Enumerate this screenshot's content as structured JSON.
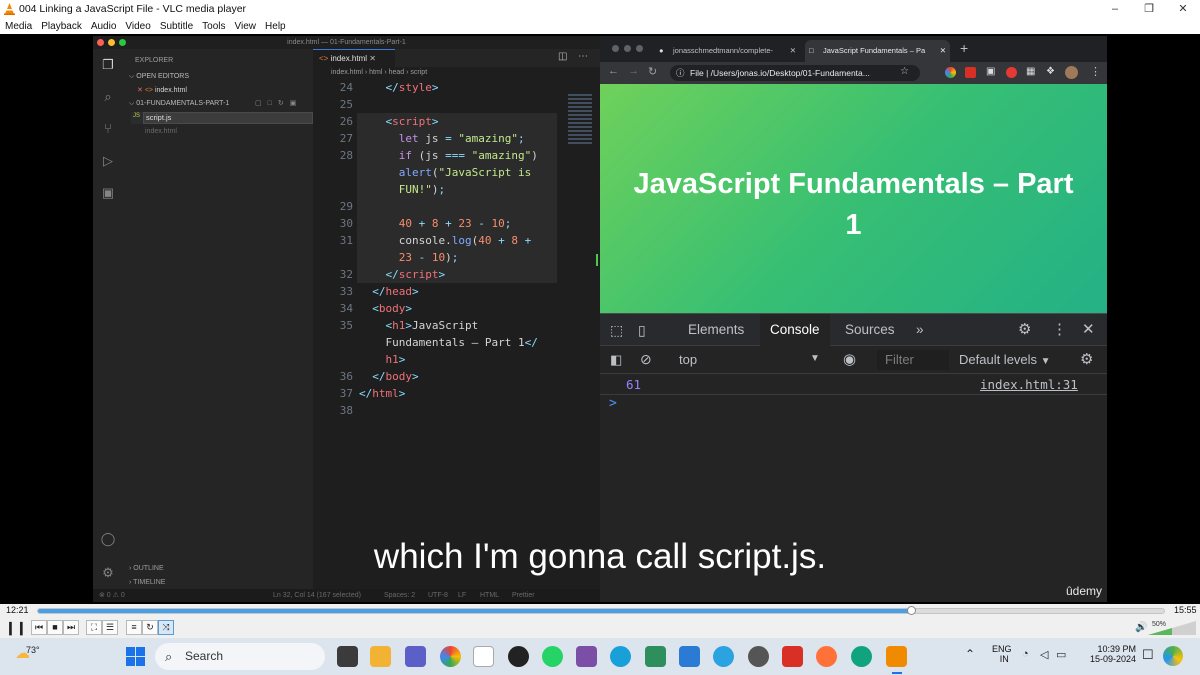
{
  "vlc": {
    "title": "004 Linking a JavaScript File - VLC media player",
    "menu": [
      "Media",
      "Playback",
      "Audio",
      "Video",
      "Subtitle",
      "Tools",
      "View",
      "Help"
    ],
    "time_elapsed": "12:21",
    "time_total": "15:55",
    "progress": 0.776,
    "volume_label": "50%",
    "volume": 0.5
  },
  "vscode": {
    "window_title": "index.html — 01-Fundamentals-Part-1",
    "explorer_label": "EXPLORER",
    "open_editors_label": "OPEN EDITORS",
    "open_editor_item": "index.html",
    "folder_label": "01-FUNDAMENTALS-PART-1",
    "new_file_input": "script.js",
    "file_index": "index.html",
    "outline_label": "OUTLINE",
    "timeline_label": "TIMELINE",
    "tab_label": "index.html",
    "breadcrumb": [
      "index.html",
      "html",
      "head",
      "script"
    ],
    "status": {
      "position": "Ln 32, Col 14 (167 selected)",
      "spaces": "Spaces: 2",
      "encoding": "UTF-8",
      "eol": "LF",
      "language": "HTML",
      "prettier": "Prettier"
    },
    "line_numbers": [
      "24",
      "25",
      "26",
      "27",
      "28",
      "29",
      "30",
      "31",
      "32",
      "33",
      "34",
      "35",
      "36",
      "37",
      "38"
    ]
  },
  "chrome": {
    "tab1": "jonasschmedtmann/complete-",
    "tab2": "JavaScript Fundamentals – Pa",
    "address_scheme": "File",
    "address": "/Users/jonas.io/Desktop/01-Fundamenta...",
    "heading": "JavaScript Fundamentals – Part 1",
    "devtools": {
      "tabs": [
        "Elements",
        "Console",
        "Sources"
      ],
      "context": "top",
      "filter_placeholder": "Filter",
      "levels": "Default levels",
      "log_value": "61",
      "log_source": "index.html:31",
      "prompt": ">"
    }
  },
  "subtitle": "which I'm gonna call script.js.",
  "watermark": "ûdemy",
  "taskbar": {
    "weather": "73°",
    "search_label": "Search",
    "lang_line1": "ENG",
    "lang_line2": "IN",
    "time": "10:39 PM",
    "date": "15-09-2024"
  }
}
